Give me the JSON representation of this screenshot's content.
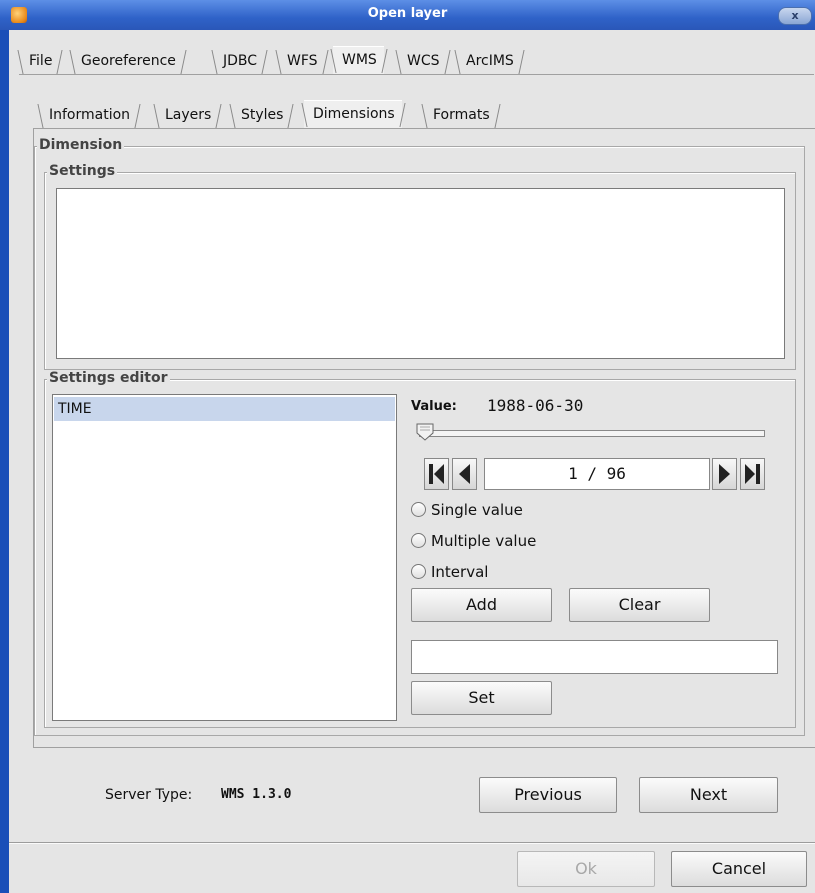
{
  "window": {
    "title": "Open layer",
    "close_label": "x"
  },
  "main_tabs": [
    {
      "label": "File"
    },
    {
      "label": "Georeference"
    },
    {
      "label": "JDBC"
    },
    {
      "label": "WFS"
    },
    {
      "label": "WMS"
    },
    {
      "label": "WCS"
    },
    {
      "label": "ArcIMS"
    }
  ],
  "main_tabs_active": "WMS",
  "sub_tabs": [
    {
      "label": "Information"
    },
    {
      "label": "Layers"
    },
    {
      "label": "Styles"
    },
    {
      "label": "Dimensions"
    },
    {
      "label": "Formats"
    }
  ],
  "sub_tabs_active": "Dimensions",
  "dimension": {
    "group_label": "Dimension",
    "settings_label": "Settings",
    "settings_editor_label": "Settings editor",
    "list_items": [
      "TIME"
    ],
    "value_label": "Value:",
    "value": "1988-06-30",
    "slider_fraction": 0.0,
    "counter": "1 / 96",
    "radios": [
      {
        "label": "Single value"
      },
      {
        "label": "Multiple value"
      },
      {
        "label": "Interval"
      }
    ],
    "add_label": "Add",
    "clear_label": "Clear",
    "set_label": "Set",
    "text_value": ""
  },
  "footer": {
    "server_type_label": "Server Type:",
    "server_type_value": "WMS 1.3.0",
    "previous_label": "Previous",
    "next_label": "Next",
    "ok_label": "Ok",
    "cancel_label": "Cancel"
  },
  "colors": {
    "titlebar": "#2f62c8",
    "window_bg": "#e5e5e5",
    "selection": "#c8d6ec"
  },
  "icons": {
    "app": "app-globe-icon",
    "first": "first-record-icon",
    "prev": "previous-record-icon",
    "next": "next-record-icon",
    "last": "last-record-icon"
  }
}
